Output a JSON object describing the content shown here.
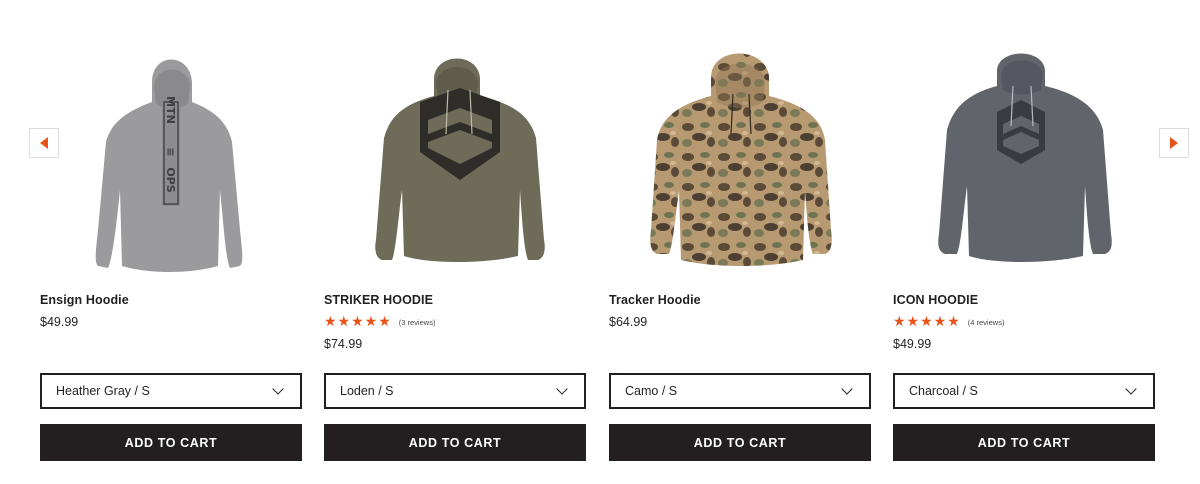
{
  "products": [
    {
      "title": "Ensign Hoodie",
      "price": "$49.99",
      "variant": "Heather Gray / S",
      "cta": "ADD TO CART",
      "image_icon": "heather-gray-hoodie-back",
      "color": "#9b9b9d"
    },
    {
      "title": "STRIKER HOODIE",
      "stars": "★★★★★",
      "rating": 5,
      "reviews": "(3 reviews)",
      "price": "$74.99",
      "variant": "Loden / S",
      "cta": "ADD TO CART",
      "image_icon": "loden-hoodie-front",
      "color": "#6e6b59"
    },
    {
      "title": "Tracker Hoodie",
      "price": "$64.99",
      "variant": "Camo / S",
      "cta": "ADD TO CART",
      "image_icon": "camo-hoodie-front",
      "color": "#a88a64"
    },
    {
      "title": "ICON HOODIE",
      "stars": "★★★★★",
      "rating": 5,
      "reviews": "(4 reviews)",
      "price": "$49.99",
      "variant": "Charcoal / S",
      "cta": "ADD TO CART",
      "image_icon": "charcoal-hoodie-front",
      "color": "#62646c"
    }
  ],
  "nav": {
    "prev_icon": "chevron-left-icon",
    "next_icon": "chevron-right-icon",
    "accent": "#e8531b"
  },
  "theme": {
    "button_bg": "#231f20",
    "text": "#231f20",
    "star": "#e8531b"
  }
}
